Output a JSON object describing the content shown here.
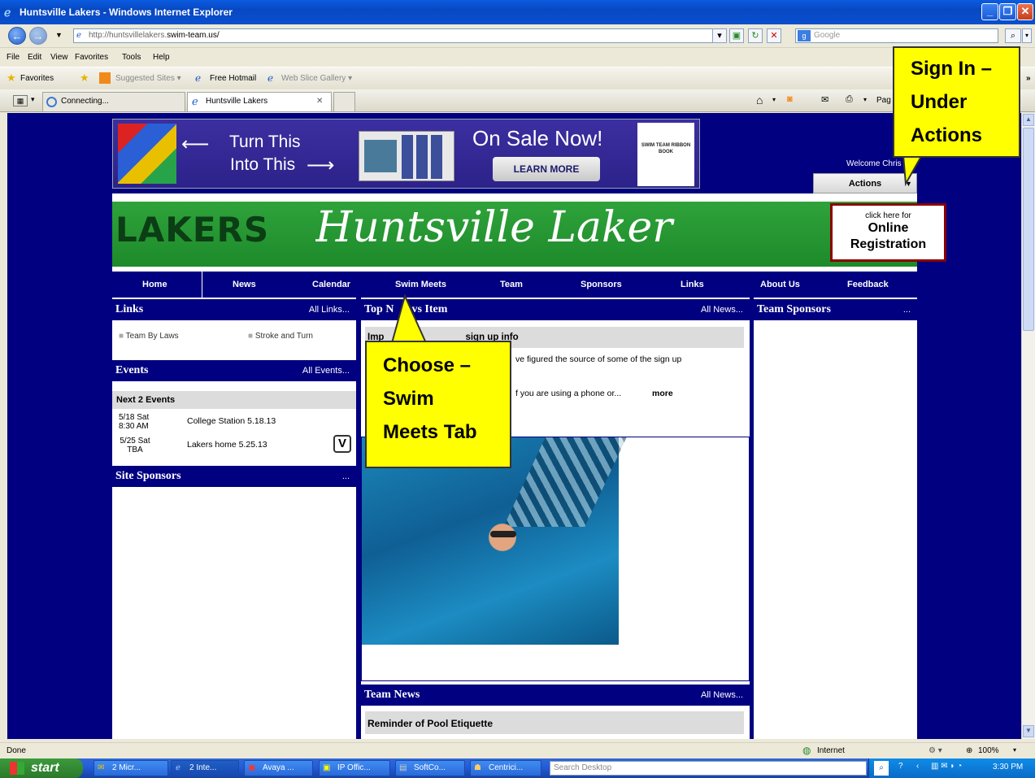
{
  "window": {
    "title": "Huntsville Lakers - Windows Internet Explorer"
  },
  "address": {
    "url_prefix": "http://huntsvillelakers.",
    "url_domain": "swim-team.us/",
    "search_placeholder": "Google"
  },
  "menu": [
    "File",
    "Edit",
    "View",
    "Favorites",
    "Tools",
    "Help"
  ],
  "favorites_bar": {
    "favorites": "Favorites",
    "suggested": "Suggested Sites ▾",
    "hotmail": "Free Hotmail",
    "webslice": "Web Slice Gallery ▾"
  },
  "tabs": [
    {
      "label": "Connecting..."
    },
    {
      "label": "Huntsville Lakers"
    }
  ],
  "toolbar_page": "Pag",
  "banner": {
    "turn_this": "Turn This",
    "into_this": "Into This",
    "on_sale": "On Sale Now!",
    "learn_more": "LEARN MORE",
    "book_text": "SWIM TEAM RIBBON BOOK"
  },
  "user": {
    "welcome": "Welcome Chris Blai",
    "actions": "Actions"
  },
  "header": {
    "logo": "LAKERS",
    "script_title": "Huntsville Laker",
    "reg_small": "click here for",
    "reg_line1": "Online",
    "reg_line2": "Registration"
  },
  "nav": [
    "Home",
    "News",
    "Calendar",
    "Swim Meets",
    "Team",
    "Sponsors",
    "Links",
    "About Us",
    "Feedback"
  ],
  "links_panel": {
    "title": "Links",
    "all": "All Links...",
    "items": [
      "Team By Laws",
      "Stroke and Turn"
    ]
  },
  "events_panel": {
    "title": "Events",
    "all": "All Events...",
    "sub": "Next 2 Events",
    "items": [
      {
        "date": "5/18 Sat",
        "time": "8:30 AM",
        "name": "College Station 5.18.13"
      },
      {
        "date": "5/25 Sat",
        "time": "TBA",
        "name": "Lakers home 5.25.13"
      }
    ]
  },
  "site_sponsors": {
    "title": "Site Sponsors",
    "more": "..."
  },
  "top_news": {
    "title": "Top N",
    "title_tail": "vs Item",
    "all": "All News...",
    "headline": "Imp",
    "headline_tail": "sign up info",
    "line1": "ve figured the source of some of the sign up",
    "line2": "f you are using a phone or...",
    "more": "more"
  },
  "team_news": {
    "title": "Team News",
    "all": "All News...",
    "item": "Reminder of Pool Etiquette"
  },
  "team_sponsors": {
    "title": "Team Sponsors",
    "more": "..."
  },
  "callouts": {
    "signin": [
      "Sign In –",
      "Under",
      "Actions"
    ],
    "choose": [
      "Choose –",
      "Swim",
      "Meets Tab"
    ]
  },
  "status": {
    "left": "Done",
    "zone": "Internet",
    "zoom": "100%"
  },
  "taskbar": {
    "start": "start",
    "tasks": [
      "2 Micr...",
      "2 Inte...",
      "Avaya ...",
      "IP Offic...",
      "SoftCo...",
      "Centrici..."
    ],
    "search": "Search Desktop",
    "clock": "3:30 PM"
  },
  "colors": {
    "navy": "#000080",
    "callout": "#ffff00",
    "green": "#2fa33b",
    "reg_border": "#8b0000"
  }
}
